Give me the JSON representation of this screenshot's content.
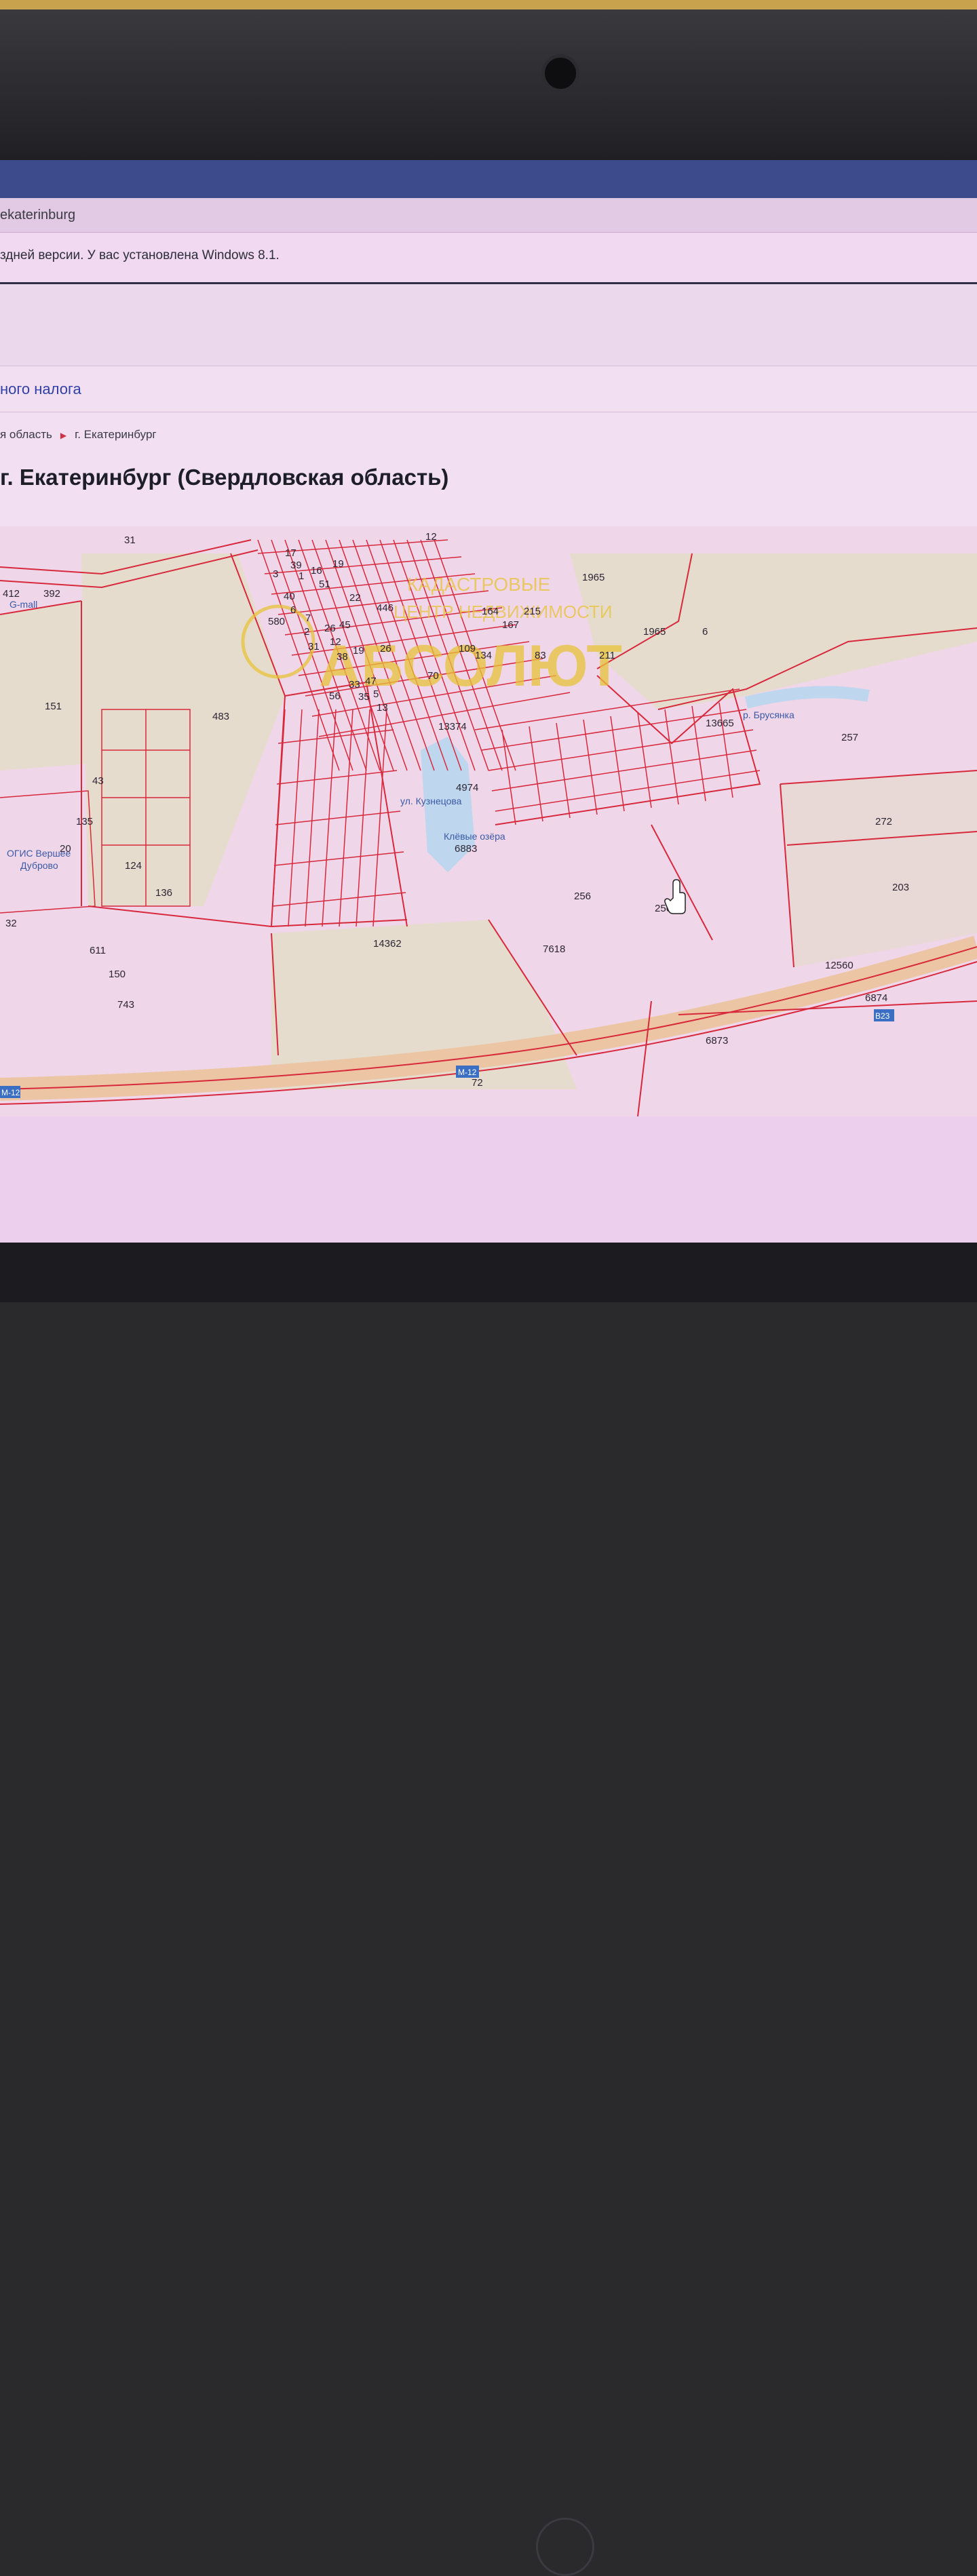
{
  "browser": {
    "title_fragment": "ekaterinburg"
  },
  "notice": {
    "text": "здней версии. У вас установлена Windows 8.1."
  },
  "page": {
    "nav_link": "ного налога",
    "breadcrumb": {
      "parent": "я область",
      "current": "г. Екатеринбург"
    },
    "title": "г. Екатеринбург (Свердловская область)"
  },
  "map": {
    "watermark_text": "АБСОЛЮТ",
    "watermark_subtitle_1": "КАДАСТРОВЫЕ",
    "watermark_subtitle_2": "ЦЕНТР НЕДВИЖИМОСТИ",
    "colors": {
      "background": "#efd6e8",
      "field": "#e6dccd",
      "boundary": "#d8283c",
      "road": "#ecc6a4",
      "water": "#bfd7ee",
      "watermark": "#e8c33a"
    },
    "parcel_labels": [
      "31",
      "392",
      "412",
      "580",
      "3",
      "17",
      "39",
      "1",
      "16",
      "51",
      "19",
      "22",
      "446",
      "26",
      "40",
      "6",
      "7",
      "2",
      "26",
      "45",
      "12",
      "31",
      "38",
      "19",
      "33",
      "47",
      "35",
      "5",
      "13",
      "56",
      "151",
      "483",
      "43",
      "135",
      "124",
      "136",
      "32",
      "611",
      "150",
      "743",
      "20",
      "12",
      "1965",
      "1965",
      "215",
      "167",
      "83",
      "164",
      "134",
      "109",
      "70",
      "211",
      "6",
      "13665",
      "13374",
      "4974",
      "6883",
      "257",
      "272",
      "203",
      "256",
      "256",
      "14362",
      "7618",
      "12560",
      "6874",
      "6873",
      "72"
    ],
    "place_labels": [
      "Клёвые озёра",
      "ОГИС Вершее",
      "Дуброво",
      "G-mall",
      "ул. Кузнецова",
      "р. Брусянка"
    ],
    "road_badges": [
      "М-12",
      "М-12",
      "В23"
    ],
    "cursor_icon": "hand-pointer-icon"
  }
}
